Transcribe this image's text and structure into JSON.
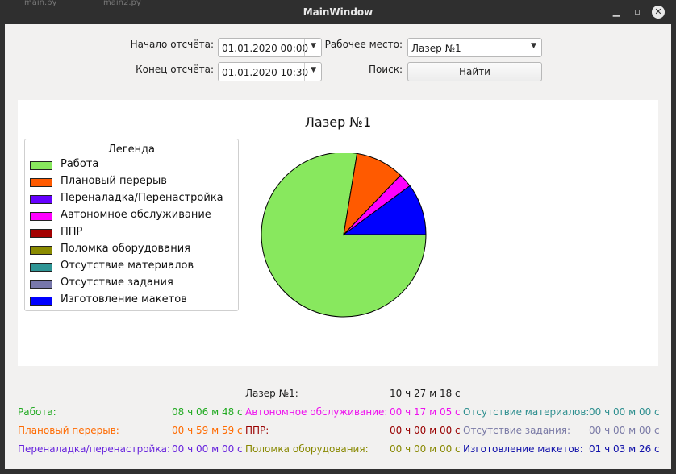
{
  "window": {
    "title": "MainWindow",
    "bg_tabs": [
      "main.py",
      "main2.py"
    ]
  },
  "controls": {
    "start_label": "Начало отсчёта:",
    "start_value": "01.01.2020 00:00",
    "end_label": "Конец отсчёта:",
    "end_value": "01.01.2020 10:30",
    "workplace_label": "Рабочее место:",
    "workplace_value": "Лазер №1",
    "search_label": "Поиск:",
    "search_button": "Найти"
  },
  "chart_data": {
    "type": "pie",
    "title": "Лазер №1",
    "legend_title": "Легенда",
    "legend_placement": "left",
    "slices": [
      {
        "label": "Работа",
        "value": 29208,
        "color": "#88e85e"
      },
      {
        "label": "Плановый перерыв",
        "value": 3599,
        "color": "#ff5a00"
      },
      {
        "label": "Переналадка/Перенастройка",
        "value": 0,
        "color": "#6600ff"
      },
      {
        "label": "Автономное обслуживание",
        "value": 1025,
        "color": "#ff00ff"
      },
      {
        "label": "ППР",
        "value": 0,
        "color": "#a30000"
      },
      {
        "label": "Поломка оборудования",
        "value": 0,
        "color": "#8a8a00"
      },
      {
        "label": "Отсутствие материалов",
        "value": 0,
        "color": "#2e9595"
      },
      {
        "label": "Отсутствие задания",
        "value": 0,
        "color": "#7777aa"
      },
      {
        "label": "Изготовление макетов",
        "value": 3806,
        "color": "#0000ff"
      }
    ]
  },
  "stats": {
    "total_label": "Лазер №1:",
    "total_value": "10 ч 27 м 18 с",
    "items": [
      {
        "label": "Работа:",
        "value": "08 ч 06 м 48 с",
        "color": "#22aa22"
      },
      {
        "label": "Плановый перерыв:",
        "value": "00 ч 59 м 59 с",
        "color": "#ff6a00"
      },
      {
        "label": "Переналадка/перенастройка:",
        "value": "00 ч 00 м 00 с",
        "color": "#6622dd"
      },
      {
        "label": "Автономное обслуживание:",
        "value": "00 ч 17 м 05 с",
        "color": "#ee11ee"
      },
      {
        "label": "ППР:",
        "value": "00 ч 00 м 00 с",
        "color": "#990000"
      },
      {
        "label": "Поломка оборудования:",
        "value": "00 ч 00 м 00 с",
        "color": "#888800"
      },
      {
        "label": "Отсутствие материалов:",
        "value": "00 ч 00 м 00 с",
        "color": "#2e8f8f"
      },
      {
        "label": "Отсутствие задания:",
        "value": "00 ч 00 м 00 с",
        "color": "#7a7aa6"
      },
      {
        "label": "Изготовление макетов:",
        "value": "01 ч 03 м 26 с",
        "color": "#1111aa"
      }
    ]
  }
}
